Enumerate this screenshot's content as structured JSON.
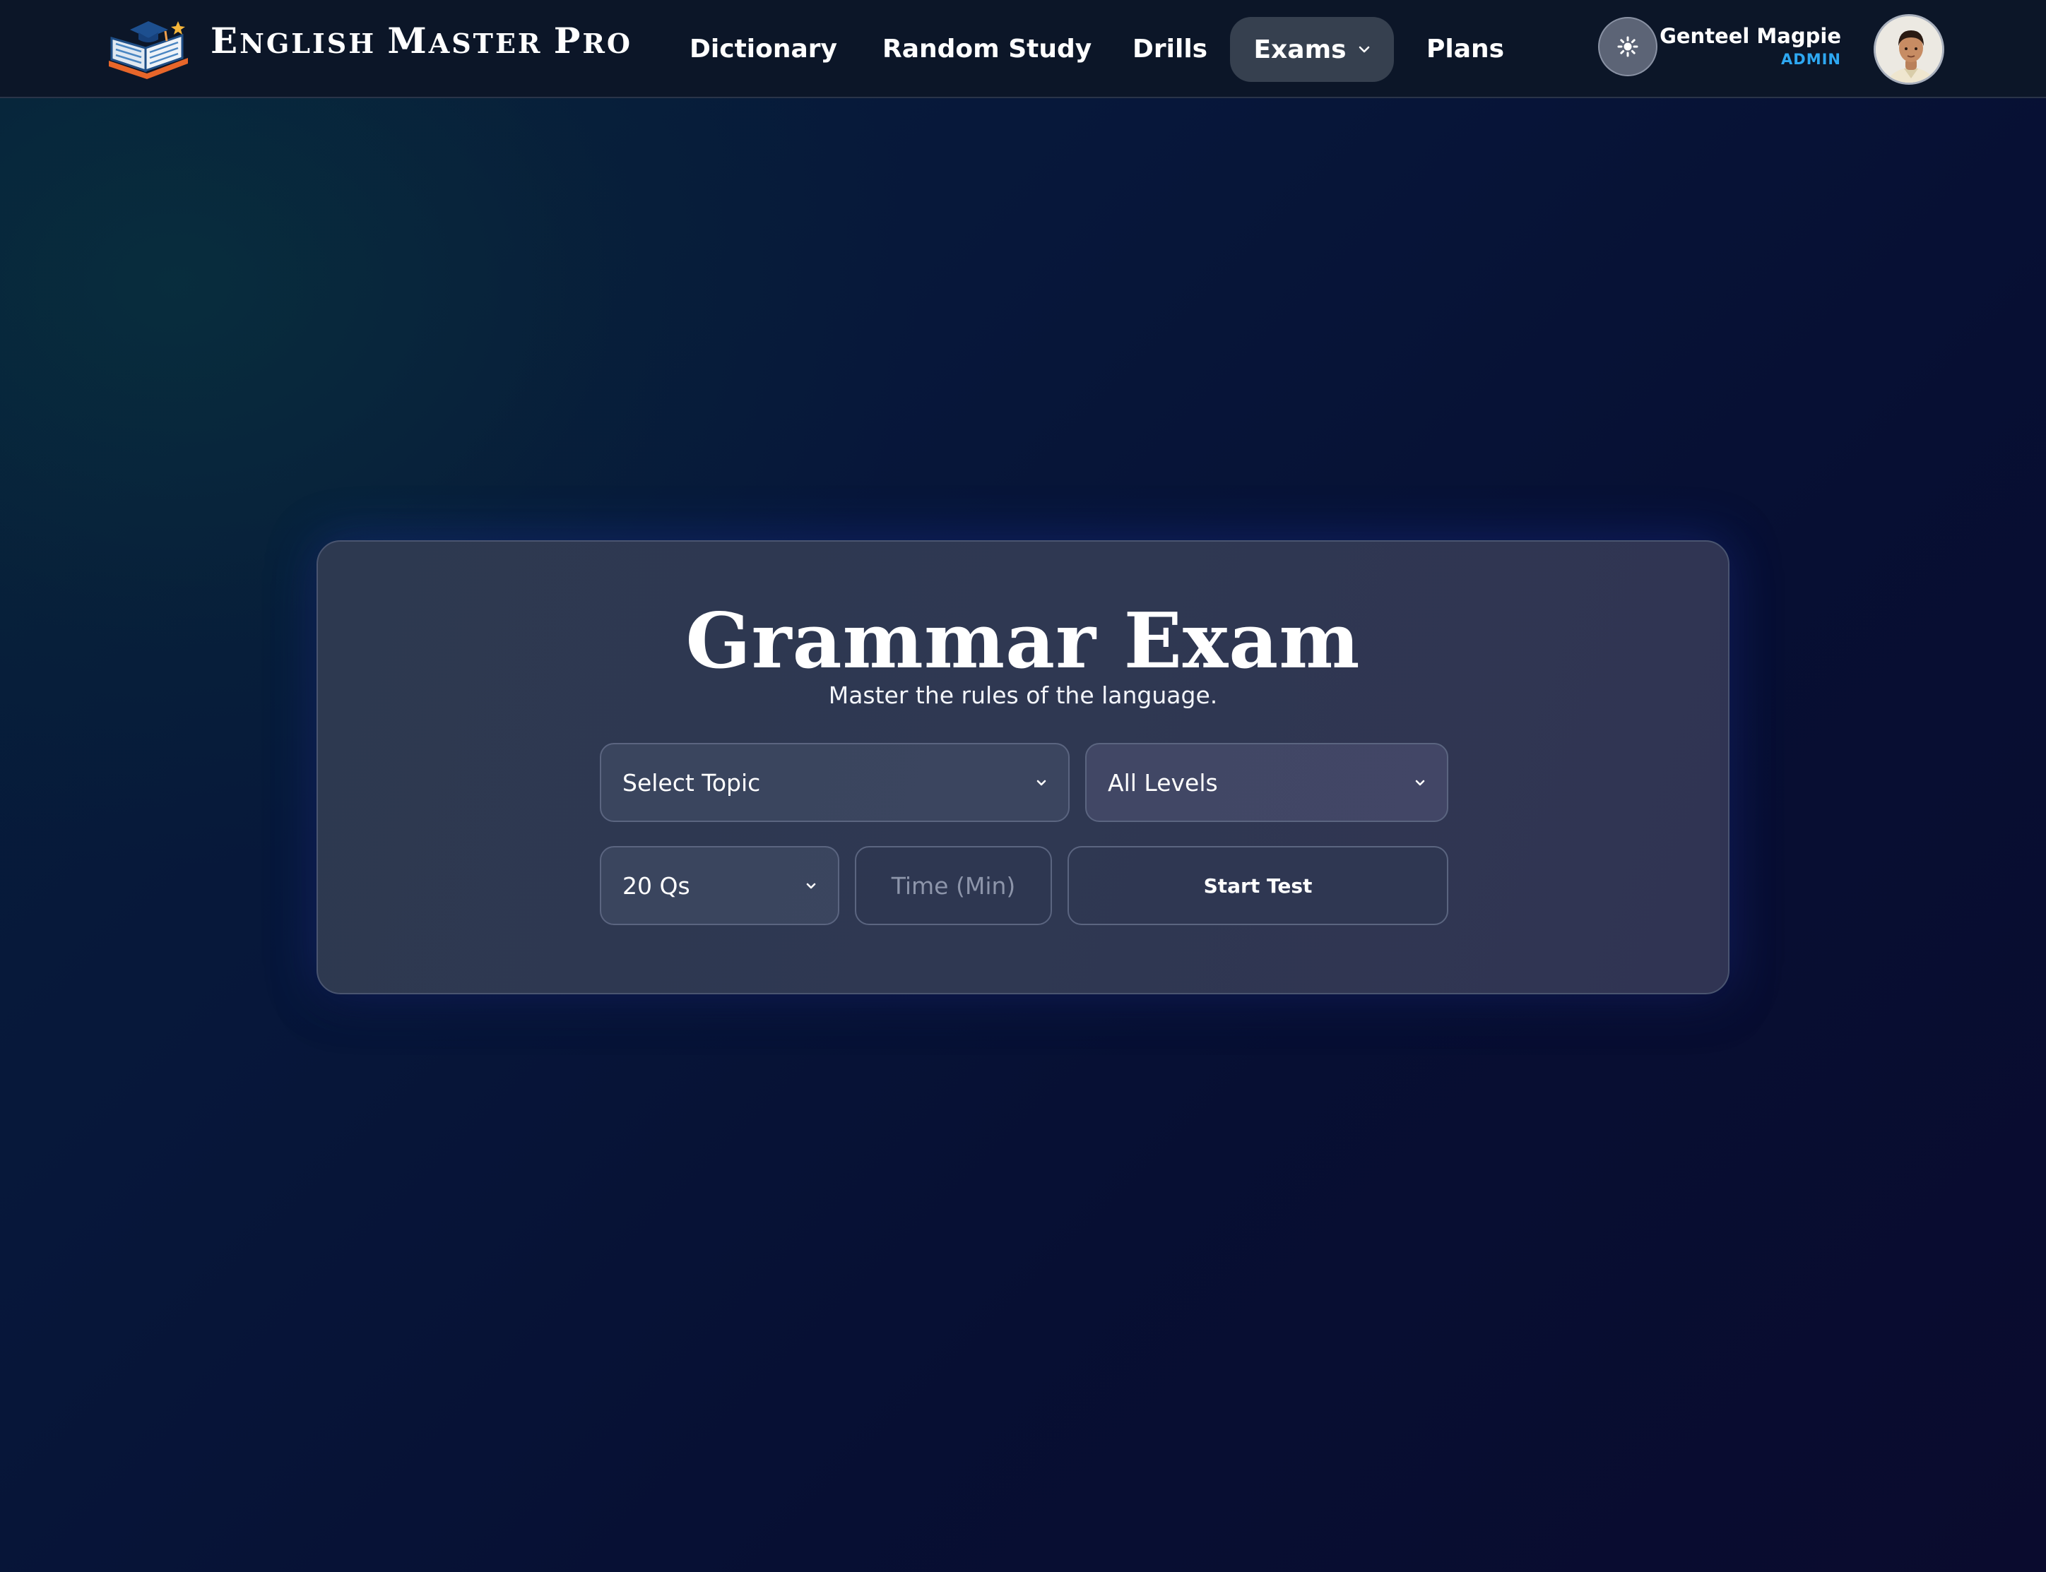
{
  "brand": {
    "name_first_cap": "E",
    "name_first_rest": "NGLISH",
    "name_second_cap": "M",
    "name_second_rest": "ASTER",
    "name_third_cap": "P",
    "name_third_rest": "RO"
  },
  "nav": {
    "items": [
      {
        "label": "Dictionary"
      },
      {
        "label": "Random Study"
      },
      {
        "label": "Drills"
      },
      {
        "label": "Exams"
      },
      {
        "label": "Plans"
      }
    ],
    "active": "Exams"
  },
  "user": {
    "name": "Genteel Magpie",
    "role": "ADMIN"
  },
  "exam": {
    "title": "Grammar Exam",
    "subtitle": "Master the rules of the language.",
    "topic_select": "Select Topic",
    "level_select": "All Levels",
    "questions_select": "20 Qs",
    "time_placeholder": "Time (Min)",
    "start_label": "Start Test"
  },
  "colors": {
    "nav_bg": "#0c1628",
    "active_pill": "#36404f",
    "role_accent": "#2ea8f2",
    "card_bg": "#2f3852"
  },
  "icons": [
    "book-logo-icon",
    "chevron-down-icon",
    "sun-icon",
    "avatar"
  ]
}
